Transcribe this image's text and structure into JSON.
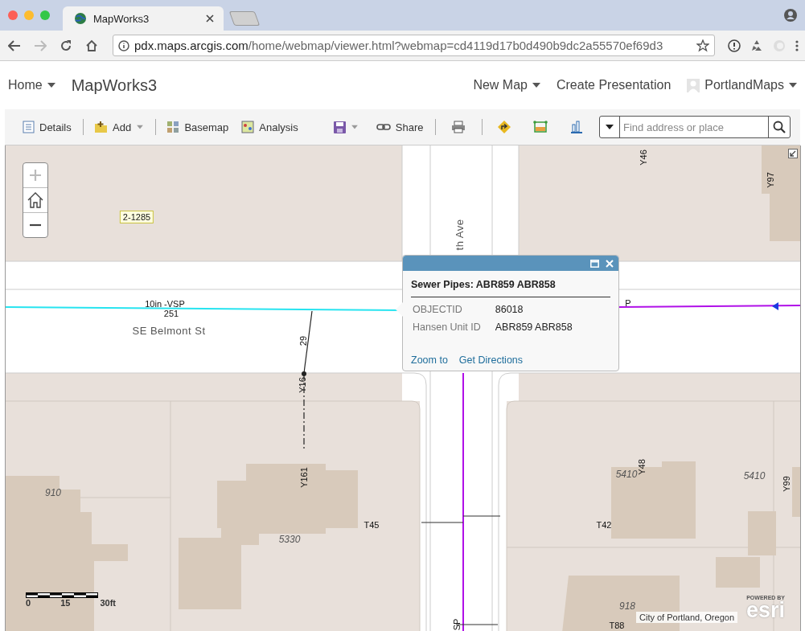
{
  "browser": {
    "tabs": [
      {
        "title": "MapWorks3",
        "selected": true
      }
    ],
    "url_host": "pdx.maps.arcgis.com",
    "url_path": "/home/webmap/viewer.html?webmap=cd4119d17b0d490b9dc2a55570ef69d3"
  },
  "header": {
    "home": "Home",
    "title": "MapWorks3",
    "menus": [
      {
        "label": "New Map",
        "dropdown": true
      },
      {
        "label": "Create Presentation",
        "dropdown": false
      },
      {
        "label": "PortlandMaps",
        "dropdown": true
      }
    ]
  },
  "toolbar": {
    "items": [
      {
        "kind": "text",
        "label": "Details",
        "dropdown": false
      },
      {
        "kind": "text",
        "label": "Add",
        "dropdown": true
      },
      {
        "kind": "text",
        "label": "Basemap",
        "dropdown": false
      },
      {
        "kind": "text",
        "label": "Analysis",
        "dropdown": false
      },
      {
        "kind": "icon",
        "dropdown": true
      },
      {
        "kind": "text",
        "label": "Share",
        "dropdown": false
      },
      {
        "kind": "icon",
        "dropdown": false
      },
      {
        "kind": "icon",
        "dropdown": false
      },
      {
        "kind": "icon",
        "dropdown": false
      },
      {
        "kind": "icon",
        "dropdown": false
      }
    ],
    "search": {
      "placeholder": "Find address or place"
    }
  },
  "map": {
    "labels": [
      {
        "kind": "tag",
        "text": "2-1285"
      },
      {
        "kind": "street",
        "text": "th Ave"
      },
      {
        "kind": "asset",
        "text": "Y46"
      },
      {
        "kind": "asset",
        "text": "Y97"
      },
      {
        "kind": "asset",
        "text": "10in -VSP"
      },
      {
        "kind": "asset",
        "text": "251"
      },
      {
        "kind": "asset",
        "text": "P"
      },
      {
        "kind": "street",
        "text": "SE Belmont St"
      },
      {
        "kind": "asset",
        "text": "29"
      },
      {
        "kind": "asset",
        "text": "Y16"
      },
      {
        "kind": "asset",
        "text": "Y161"
      },
      {
        "kind": "address",
        "text": "910"
      },
      {
        "kind": "address",
        "text": "5330"
      },
      {
        "kind": "asset",
        "text": "T45"
      },
      {
        "kind": "address",
        "text": "5410"
      },
      {
        "kind": "asset",
        "text": "Y48"
      },
      {
        "kind": "address",
        "text": "5410"
      },
      {
        "kind": "asset",
        "text": "Y99"
      },
      {
        "kind": "asset",
        "text": "T42"
      },
      {
        "kind": "address",
        "text": "918"
      },
      {
        "kind": "asset",
        "text": "SP"
      },
      {
        "kind": "asset",
        "text": "T88"
      }
    ],
    "popup": {
      "title": "Sewer Pipes: ABR859 ABR858",
      "fields": [
        {
          "label": "OBJECTID",
          "value": "86018"
        },
        {
          "label": "Hansen Unit ID",
          "value": "ABR859 ABR858"
        }
      ],
      "actions": [
        "Zoom to",
        "Get Directions"
      ]
    },
    "scale": [
      "0",
      "15",
      "30ft"
    ],
    "attribution": "City of Portland, Oregon",
    "logo": {
      "caption": "POWERED BY",
      "name": "esri"
    }
  }
}
